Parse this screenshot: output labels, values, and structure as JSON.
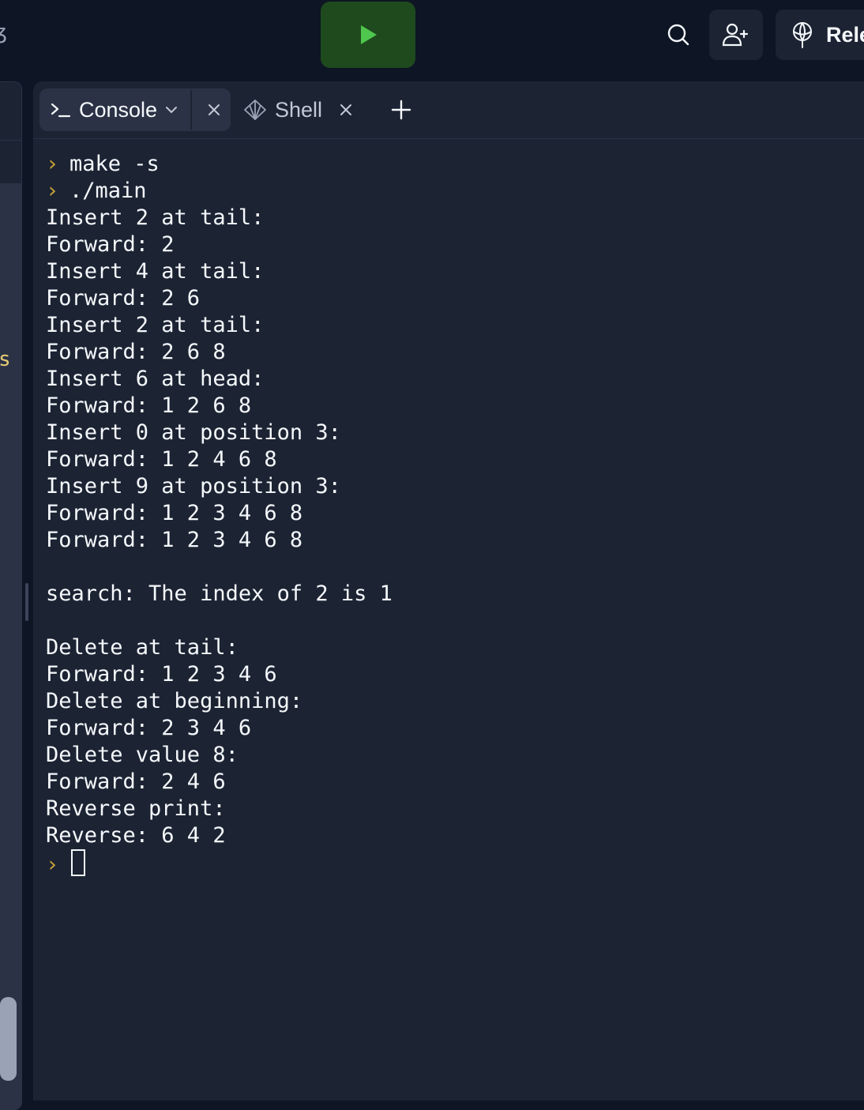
{
  "topbar": {
    "left_glyph": "ʒ",
    "release_label": "Rele"
  },
  "sidebar": {
    "partial_letter": "s"
  },
  "tabs": {
    "console_label": "Console",
    "shell_label": "Shell"
  },
  "console": {
    "prompt_glyph": "›",
    "lines": [
      {
        "type": "cmd",
        "text": "make -s"
      },
      {
        "type": "cmd",
        "text": "./main"
      },
      {
        "type": "out",
        "text": "Insert 2 at tail:"
      },
      {
        "type": "out",
        "text": "Forward: 2"
      },
      {
        "type": "out",
        "text": "Insert 4 at tail:"
      },
      {
        "type": "out",
        "text": "Forward: 2 6"
      },
      {
        "type": "out",
        "text": "Insert 2 at tail:"
      },
      {
        "type": "out",
        "text": "Forward: 2 6 8"
      },
      {
        "type": "out",
        "text": "Insert 6 at head:"
      },
      {
        "type": "out",
        "text": "Forward: 1 2 6 8"
      },
      {
        "type": "out",
        "text": "Insert 0 at position 3:"
      },
      {
        "type": "out",
        "text": "Forward: 1 2 4 6 8"
      },
      {
        "type": "out",
        "text": "Insert 9 at position 3:"
      },
      {
        "type": "out",
        "text": "Forward: 1 2 3 4 6 8"
      },
      {
        "type": "out",
        "text": "Forward: 1 2 3 4 6 8"
      },
      {
        "type": "out",
        "text": ""
      },
      {
        "type": "out",
        "text": "search: The index of 2 is 1"
      },
      {
        "type": "out",
        "text": ""
      },
      {
        "type": "out",
        "text": "Delete at tail:"
      },
      {
        "type": "out",
        "text": "Forward: 1 2 3 4 6"
      },
      {
        "type": "out",
        "text": "Delete at beginning:"
      },
      {
        "type": "out",
        "text": "Forward: 2 3 4 6"
      },
      {
        "type": "out",
        "text": "Delete value 8:"
      },
      {
        "type": "out",
        "text": "Forward: 2 4 6"
      },
      {
        "type": "out",
        "text": "Reverse print:"
      },
      {
        "type": "out",
        "text": "Reverse: 6 4 2"
      }
    ]
  },
  "colors": {
    "background": "#0e1525",
    "pane": "#1c2333",
    "run_button": "#1e4a1d",
    "run_icon": "#4fc64d",
    "prompt": "#c9a437",
    "text": "#f5f9fc"
  }
}
